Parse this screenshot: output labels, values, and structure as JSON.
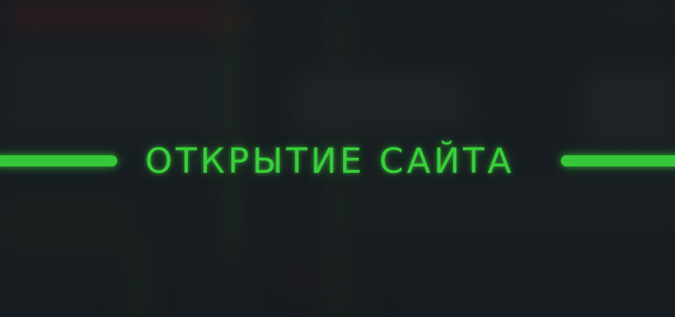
{
  "banner": {
    "title": "ОТКРЫТИЕ САЙТА",
    "accent_color": "#39cf3b",
    "background_color": "#1b2025"
  }
}
